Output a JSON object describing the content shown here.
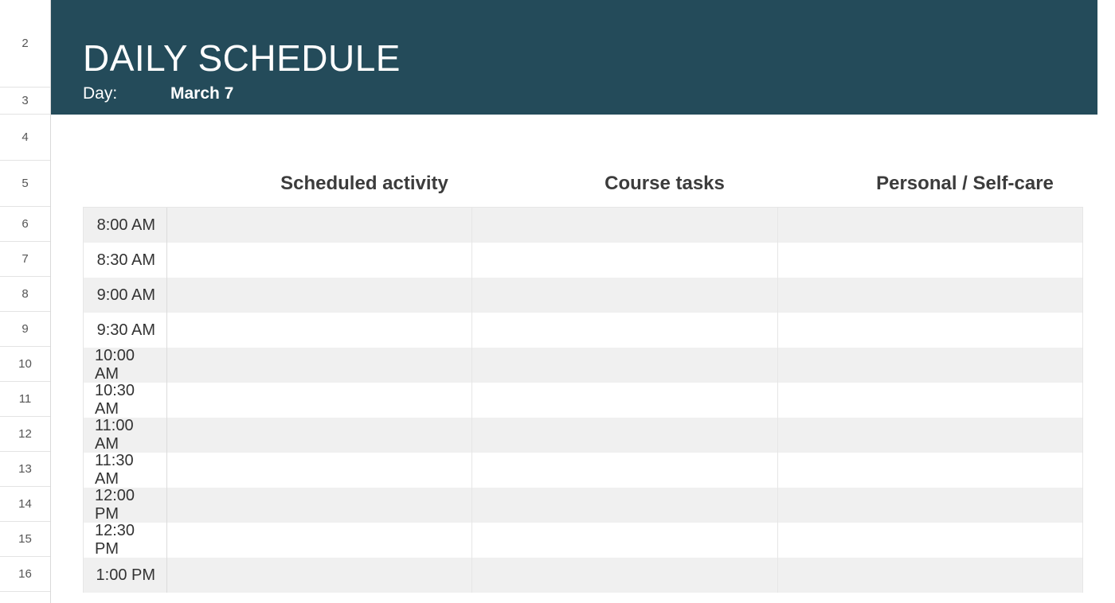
{
  "title": "DAILY SCHEDULE",
  "day_label": "Day:",
  "day_value": "March 7",
  "columns": {
    "activity": "Scheduled activity",
    "course": "Course tasks",
    "personal": "Personal / Self-care"
  },
  "row_numbers": [
    "2",
    "3",
    "4",
    "5",
    "6",
    "7",
    "8",
    "9",
    "10",
    "11",
    "12",
    "13",
    "14",
    "15",
    "16"
  ],
  "times": [
    "8:00 AM",
    "8:30 AM",
    "9:00 AM",
    "9:30 AM",
    "10:00 AM",
    "10:30 AM",
    "11:00 AM",
    "11:30 AM",
    "12:00 PM",
    "12:30 PM",
    "1:00 PM"
  ],
  "schedule": [
    {
      "time": "8:00 AM",
      "activity": "",
      "course": "",
      "personal": ""
    },
    {
      "time": "8:30 AM",
      "activity": "",
      "course": "",
      "personal": ""
    },
    {
      "time": "9:00 AM",
      "activity": "",
      "course": "",
      "personal": ""
    },
    {
      "time": "9:30 AM",
      "activity": "",
      "course": "",
      "personal": ""
    },
    {
      "time": "10:00 AM",
      "activity": "",
      "course": "",
      "personal": ""
    },
    {
      "time": "10:30 AM",
      "activity": "",
      "course": "",
      "personal": ""
    },
    {
      "time": "11:00 AM",
      "activity": "",
      "course": "",
      "personal": ""
    },
    {
      "time": "11:30 AM",
      "activity": "",
      "course": "",
      "personal": ""
    },
    {
      "time": "12:00 PM",
      "activity": "",
      "course": "",
      "personal": ""
    },
    {
      "time": "12:30 PM",
      "activity": "",
      "course": "",
      "personal": ""
    },
    {
      "time": "1:00 PM",
      "activity": "",
      "course": "",
      "personal": ""
    }
  ]
}
